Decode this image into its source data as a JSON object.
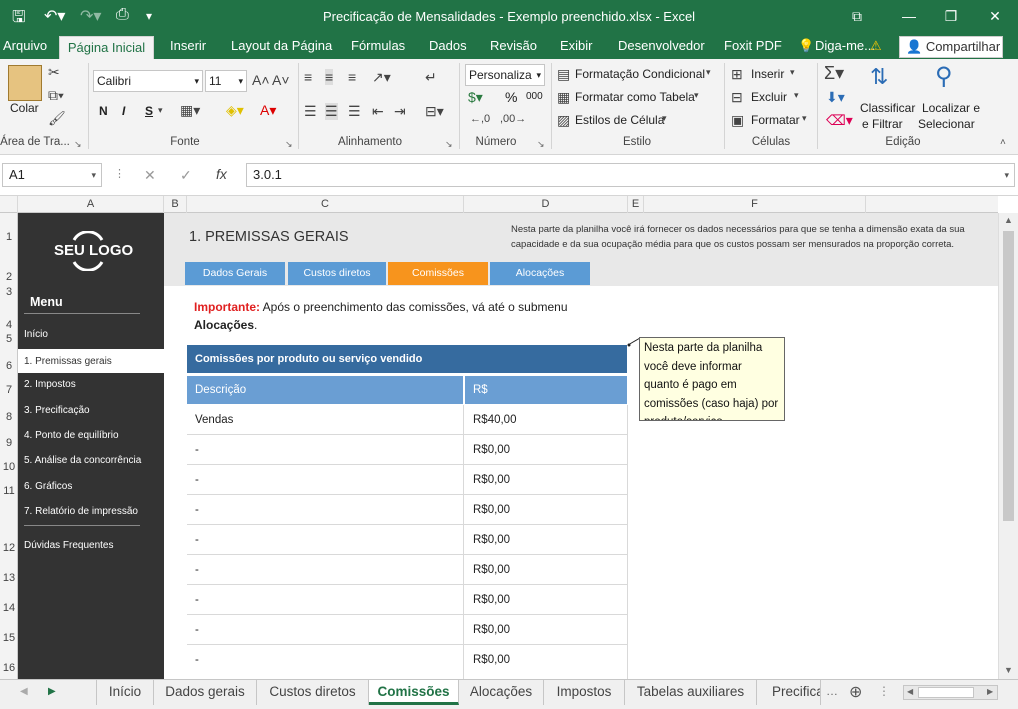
{
  "window": {
    "title": "Precificação de Mensalidades - Exemplo preenchido.xlsx - Excel"
  },
  "ribbon_tabs": [
    "Arquivo",
    "Página Inicial",
    "Inserir",
    "Layout da Página",
    "Fórmulas",
    "Dados",
    "Revisão",
    "Exibir",
    "Desenvolvedor",
    "Foxit PDF",
    "Diga-me...",
    "Compartilhar"
  ],
  "ribbon": {
    "clipboard": {
      "paste": "Colar",
      "label": "Área de Tra..."
    },
    "font": {
      "name": "Calibri",
      "size": "11",
      "bold": "N",
      "italic": "I",
      "underline": "S",
      "label": "Fonte"
    },
    "alignment": {
      "label": "Alinhamento"
    },
    "number": {
      "format": "Personaliza",
      "label": "Número",
      "percent": "%",
      "thousands": "000"
    },
    "styles": {
      "conditional": "Formatação Condicional",
      "as_table": "Formatar como Tabela",
      "cell_styles": "Estilos de Célula",
      "label": "Estilo"
    },
    "cells": {
      "insert": "Inserir",
      "delete": "Excluir",
      "format": "Formatar",
      "label": "Células"
    },
    "editing": {
      "sort1": "Classificar",
      "sort2": "e Filtrar",
      "find1": "Localizar e",
      "find2": "Selecionar",
      "label": "Edição"
    }
  },
  "formula_bar": {
    "cell_ref": "A1",
    "value": "3.0.1"
  },
  "columns": [
    "A",
    "B",
    "C",
    "D",
    "E",
    "F"
  ],
  "rows": [
    "1",
    "2",
    "3",
    "4",
    "5",
    "6",
    "7",
    "8",
    "9",
    "10",
    "11",
    "12",
    "13",
    "14",
    "15",
    "16"
  ],
  "sidebar": {
    "logo": "SEU LOGO",
    "menu_title": "Menu",
    "items": [
      "Início",
      "1. Premissas gerais",
      "2. Impostos",
      "3. Precificação",
      "4. Ponto de equilíbrio",
      "5. Análise da concorrência",
      "6. Gráficos",
      "7. Relatório de impressão",
      "Dúvidas Frequentes"
    ]
  },
  "header": {
    "title": "1. PREMISSAS GERAIS",
    "description": "Nesta parte da planilha você irá fornecer os dados necessários para que se tenha a dimensão exata da sua capacidade e da sua ocupação média para que os custos possam ser mensurados na proporção correta.",
    "subtabs": [
      "Dados Gerais",
      "Custos diretos",
      "Comissões",
      "Alocações"
    ]
  },
  "notice": {
    "label": "Importante:",
    "text": "Após o preenchimento das comissões, vá até o submenu",
    "link": "Alocações",
    "end": "."
  },
  "table": {
    "title": "Comissões por produto ou serviço vendido",
    "headers": [
      "Descrição",
      "R$"
    ],
    "rows": [
      {
        "desc": "Vendas",
        "value": "R$40,00"
      },
      {
        "desc": "-",
        "value": "R$0,00"
      },
      {
        "desc": "-",
        "value": "R$0,00"
      },
      {
        "desc": "-",
        "value": "R$0,00"
      },
      {
        "desc": "-",
        "value": "R$0,00"
      },
      {
        "desc": "-",
        "value": "R$0,00"
      },
      {
        "desc": "-",
        "value": "R$0,00"
      },
      {
        "desc": "-",
        "value": "R$0,00"
      },
      {
        "desc": "-",
        "value": "R$0,00"
      }
    ]
  },
  "comment": "Nesta parte da planilha você deve informar quanto é pago em comissões (caso haja) por produto/serviço",
  "sheet_tabs": [
    "Início",
    "Dados gerais",
    "Custos diretos",
    "Comissões",
    "Alocações",
    "Impostos",
    "Tabelas auxiliares",
    "Precifica"
  ],
  "colors": {
    "excel_green": "#217346",
    "sidebar": "#333333",
    "tab_blue": "#5b9bd5",
    "tab_active": "#f7941d",
    "table_title": "#366b9f",
    "table_header": "#6a9ed3",
    "important": "#e02020"
  }
}
